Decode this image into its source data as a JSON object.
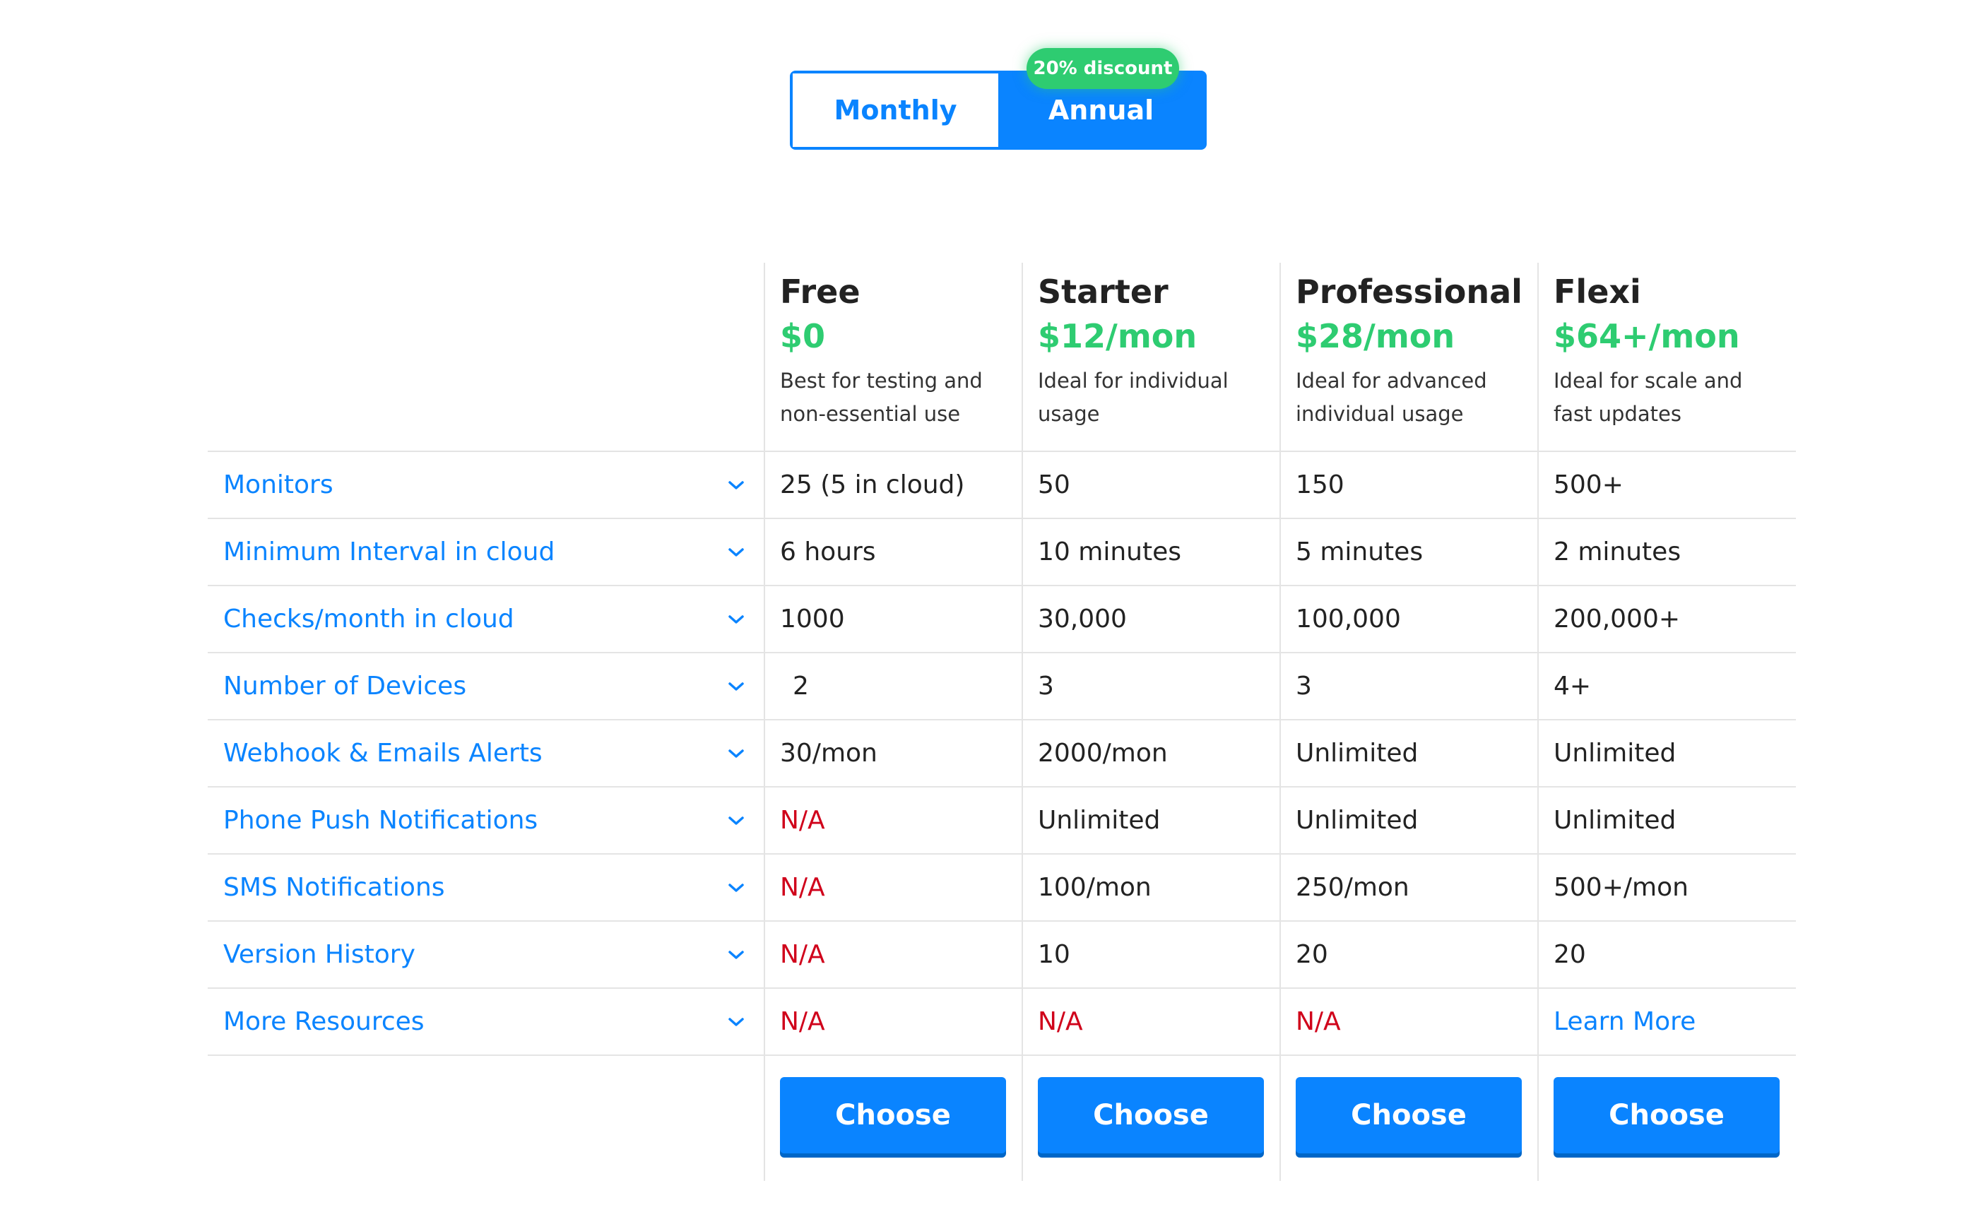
{
  "billing": {
    "monthly_label": "Monthly",
    "annual_label": "Annual",
    "discount_badge": "20% discount",
    "selected": "Annual"
  },
  "plans": [
    {
      "name": "Free",
      "price": "$0",
      "description": "Best for testing and non-essential use",
      "button_label": "Choose"
    },
    {
      "name": "Starter",
      "price": "$12/mon",
      "description": "Ideal for individual usage",
      "button_label": "Choose"
    },
    {
      "name": "Professional",
      "price": "$28/mon",
      "description": "Ideal for advanced individual usage",
      "button_label": "Choose"
    },
    {
      "name": "Flexi",
      "price": "$64+/mon",
      "description": "Ideal for scale and fast updates",
      "button_label": "Choose"
    }
  ],
  "features": [
    {
      "label": "Monitors",
      "values": [
        "25 (5 in cloud)",
        "50",
        "150",
        "500+"
      ]
    },
    {
      "label": "Minimum Interval in cloud",
      "values": [
        "6 hours",
        "10 minutes",
        "5 minutes",
        "2 minutes"
      ]
    },
    {
      "label": "Checks/month in cloud",
      "values": [
        "1000",
        "30,000",
        "100,000",
        "200,000+"
      ]
    },
    {
      "label": "Number of Devices",
      "values": [
        "2",
        "3",
        "3",
        "4+"
      ]
    },
    {
      "label": "Webhook & Emails Alerts",
      "values": [
        "30/mon",
        "2000/mon",
        "Unlimited",
        "Unlimited"
      ]
    },
    {
      "label": "Phone Push Notifications",
      "values": [
        "N/A",
        "Unlimited",
        "Unlimited",
        "Unlimited"
      ]
    },
    {
      "label": "SMS Notifications",
      "values": [
        "N/A",
        "100/mon",
        "250/mon",
        "500+/mon"
      ]
    },
    {
      "label": "Version History",
      "values": [
        "N/A",
        "10",
        "20",
        "20"
      ]
    },
    {
      "label": "More Resources",
      "values": [
        "N/A",
        "N/A",
        "N/A",
        "Learn More"
      ]
    }
  ],
  "icons": {
    "expand": "chevron-down-icon"
  },
  "colors": {
    "accent_blue": "#0a84ff",
    "price_green": "#2ecc71",
    "na_red": "#d0021b",
    "divider": "#e4e4e4"
  }
}
